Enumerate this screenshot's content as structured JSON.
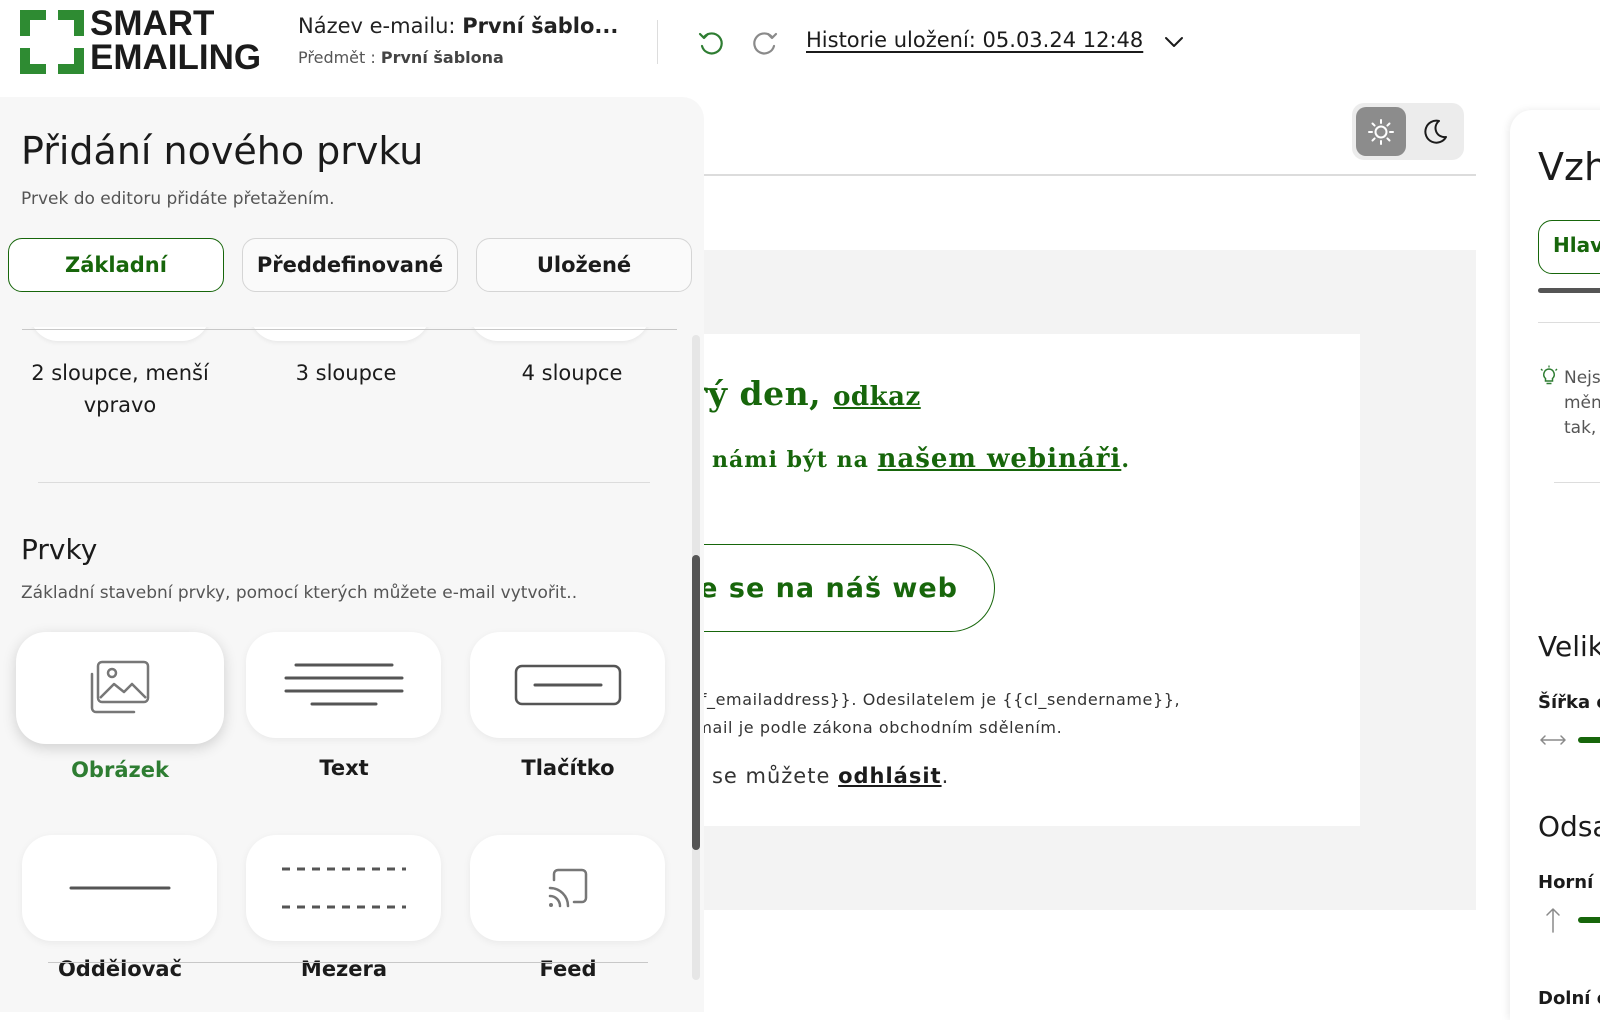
{
  "brand": {
    "logo_line1": "SMART",
    "logo_line2": "EMAILING",
    "accent_color": "#17660b",
    "logo_green": "#2e8b32"
  },
  "header": {
    "email_name_label": "Název e-mailu:",
    "email_name_value": "První šablo...",
    "subject_label": "Předmět :",
    "subject_value": "První šablona",
    "history_label": "Historie uložení: 05.03.24 12:48"
  },
  "left_panel": {
    "title": "Přidání nového prvku",
    "subtitle": "Prvek do editoru přidáte přetažením.",
    "tabs": [
      {
        "label": "Základní",
        "active": true
      },
      {
        "label": "Předdefinované",
        "active": false
      },
      {
        "label": "Uložené",
        "active": false
      }
    ],
    "layouts": [
      {
        "label": "2 sloupce, menší vpravo"
      },
      {
        "label": "3 sloupce"
      },
      {
        "label": "4 sloupce"
      }
    ],
    "elements_title": "Prvky",
    "elements_subtitle": "Základní stavební prvky, pomocí kterých můžete e-mail vytvořit..",
    "elements": [
      {
        "label": "Obrázek",
        "icon": "image-icon"
      },
      {
        "label": "Text",
        "icon": "text-lines-icon"
      },
      {
        "label": "Tlačítko",
        "icon": "button-icon"
      },
      {
        "label": "Oddělovač",
        "icon": "divider-icon"
      },
      {
        "label": "Mezera",
        "icon": "spacer-icon"
      },
      {
        "label": "Feed",
        "icon": "feed-icon"
      }
    ]
  },
  "email_preview": {
    "greeting": "rý den, ",
    "greeting_link": "odkaz",
    "invite_text": "s námi být na ",
    "invite_link": "našem webináři",
    "invite_end": ".",
    "cta_label": "jte se na náš web",
    "footer_line1": "df_emailaddress}}. Odesilatelem je {{cl_sendername}},",
    "footer_line2": "-mail je podle zákona obchodním sdělením.",
    "unsubscribe_text": "u se můžete ",
    "unsubscribe_link": "odhlásit",
    "unsubscribe_end": "."
  },
  "right_panel": {
    "title": "Vzh",
    "tab_label": "Hlav",
    "tip": "Nejs\nměn\ntak,",
    "size_title": "Velik",
    "width_label": "Šířka e",
    "padding_title": "Odsa",
    "top_label": "Horní d",
    "bottom_label": "Dolní c"
  }
}
